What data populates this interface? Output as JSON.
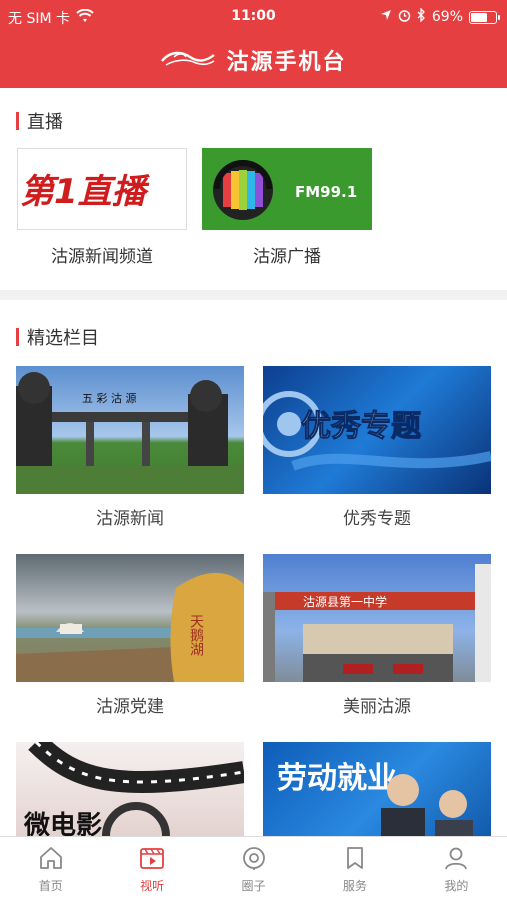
{
  "status_bar": {
    "carrier": "无 SIM 卡",
    "time": "11:00",
    "battery": "69%",
    "battery_level": 0.69
  },
  "header": {
    "title": "沽源手机台"
  },
  "live": {
    "heading": "直播",
    "items": [
      {
        "label": "沽源新闻频道",
        "thumb_text": "第1直播"
      },
      {
        "label": "沽源广播",
        "thumb_text": "FM99.1"
      }
    ]
  },
  "featured": {
    "heading": "精选栏目",
    "items": [
      {
        "label": "沽源新闻",
        "thumb_text": "五 彩 沽 源"
      },
      {
        "label": "优秀专题",
        "thumb_text": "优秀专题"
      },
      {
        "label": "沽源党建",
        "thumb_text": "天鹅湖"
      },
      {
        "label": "美丽沽源",
        "thumb_text": "沽源县第一中学"
      },
      {
        "label": "",
        "thumb_text": "微电影"
      },
      {
        "label": "",
        "thumb_text": "劳动就业"
      }
    ]
  },
  "tabbar": {
    "tabs": [
      {
        "label": "首页",
        "icon": "home-icon"
      },
      {
        "label": "视听",
        "icon": "video-icon"
      },
      {
        "label": "圈子",
        "icon": "circle-icon"
      },
      {
        "label": "服务",
        "icon": "bookmark-icon"
      },
      {
        "label": "我的",
        "icon": "person-icon"
      }
    ],
    "active_index": 1
  },
  "colors": {
    "brand": "#e53f41",
    "tab_inactive": "#888888"
  }
}
